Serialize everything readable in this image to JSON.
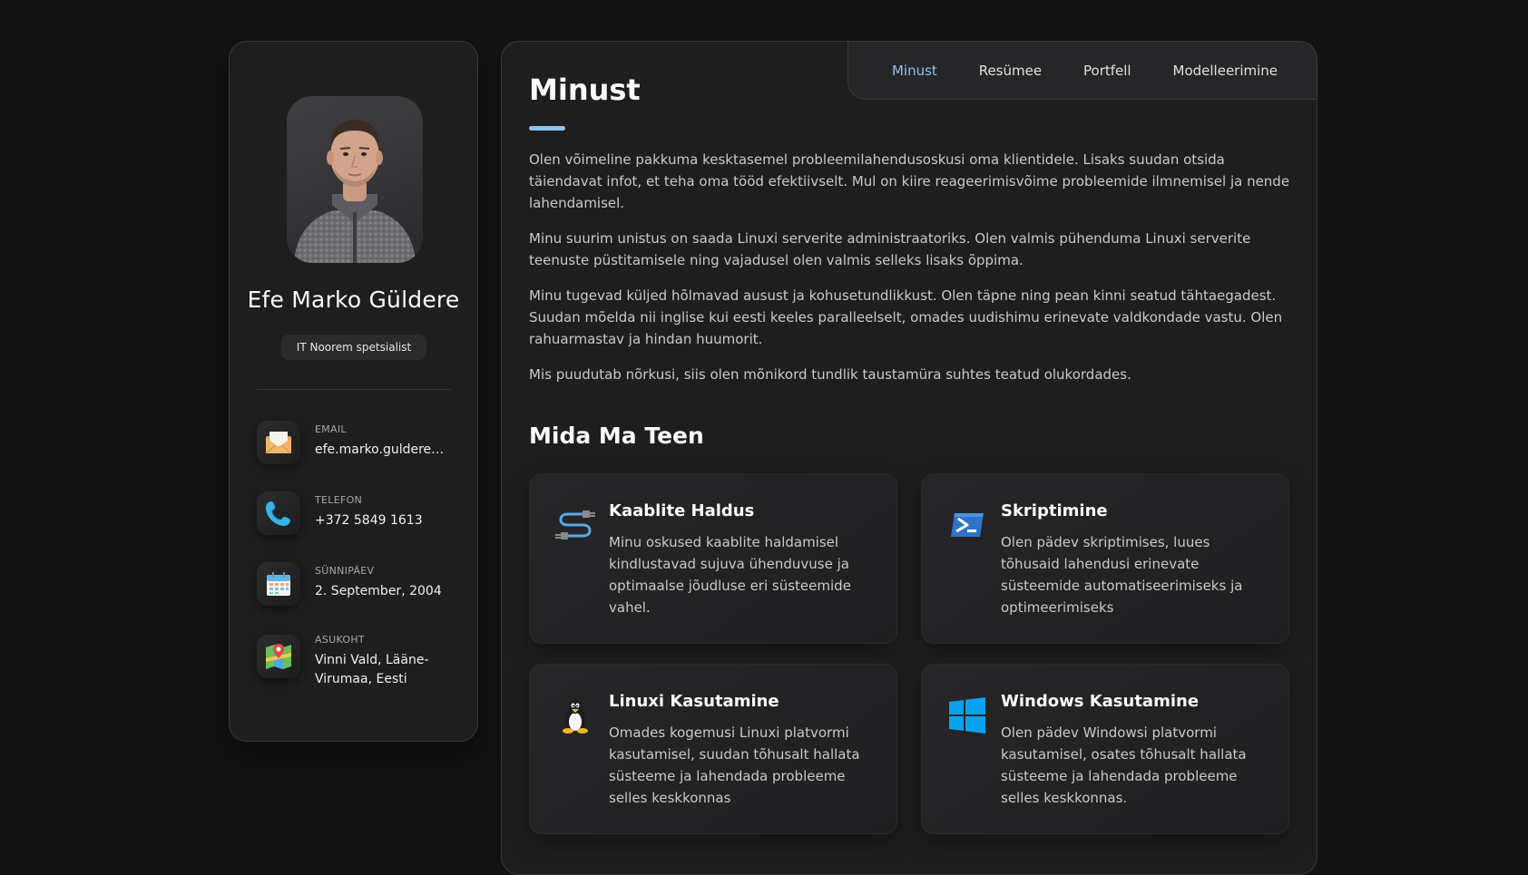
{
  "profile": {
    "name": "Efe Marko Güldere",
    "title": "IT Noorem spetsialist",
    "photo_alt": "Efe Marko Güldere"
  },
  "contacts": [
    {
      "label": "EMAIL",
      "value": "efe.marko.guldere@...",
      "icon": "envelope-icon"
    },
    {
      "label": "TELEFON",
      "value": "+372 5849 1613",
      "icon": "phone-icon"
    },
    {
      "label": "SÜNNIPÄEV",
      "value": "2. September, 2004",
      "icon": "calendar-icon"
    },
    {
      "label": "ASUKOHT",
      "value": "Vinni Vald, Lääne-Virumaa, Eesti",
      "icon": "map-icon"
    }
  ],
  "nav": {
    "items": [
      {
        "label": "Minust",
        "active": true
      },
      {
        "label": "Resümee",
        "active": false
      },
      {
        "label": "Portfell",
        "active": false
      },
      {
        "label": "Modelleerimine",
        "active": false
      }
    ]
  },
  "about": {
    "title": "Minust",
    "paragraphs": [
      "Olen võimeline pakkuma kesktasemel probleemilahendusoskusi oma klientidele. Lisaks suudan otsida täiendavat infot, et teha oma tööd efektiivselt. Mul on kiire reageerimisvõime probleemide ilmnemisel ja nende lahendamisel.",
      "Minu suurim unistus on saada Linuxi serverite administraatoriks. Olen valmis pühenduma Linuxi serverite teenuste püstitamisele ning vajadusel olen valmis selleks lisaks õppima.",
      "Minu tugevad küljed hõlmavad ausust ja kohusetundlikkust. Olen täpne ning pean kinni seatud tähtaegadest. Suudan mõelda nii inglise kui eesti keeles paralleelselt, omades uudishimu erinevate valdkondade vastu. Olen rahuarmastav ja hindan huumorit.",
      "Mis puudutab nõrkusi, siis olen mõnikord tundlik taustamüra suhtes teatud olukordades."
    ]
  },
  "services": {
    "title": "Mida Ma Teen",
    "items": [
      {
        "title": "Kaablite Haldus",
        "description": "Minu oskused kaablite haldamisel kindlustavad sujuva ühenduvuse ja optimaalse jõudluse eri süsteemide vahel.",
        "icon": "cable-icon"
      },
      {
        "title": "Skriptimine",
        "description": "Olen pädev skriptimises, luues tõhusaid lahendusi erinevate süsteemide automatiseerimiseks ja optimeerimiseks",
        "icon": "terminal-icon"
      },
      {
        "title": "Linuxi Kasutamine",
        "description": "Omades kogemusi Linuxi platvormi kasutamisel, suudan tõhusalt hallata süsteeme ja lahendada probleeme selles keskkonnas",
        "icon": "tux-penguin-icon"
      },
      {
        "title": "Windows Kasutamine",
        "description": "Olen pädev Windowsi platvormi kasutamisel, osates tõhusalt hallata süsteeme ja lahendada probleeme selles keskkonnas.",
        "icon": "windows-logo-icon"
      }
    ]
  },
  "colors": {
    "background": "#121212",
    "panel": "#1e1e1f",
    "accent": "#8ec3ec",
    "text": "#c9c9c9"
  }
}
